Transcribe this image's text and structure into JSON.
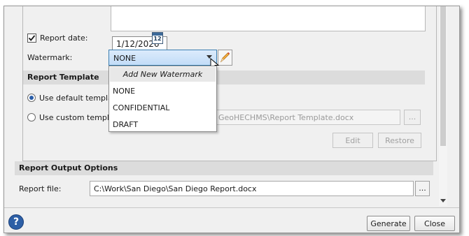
{
  "report_date": {
    "label": "Report date:",
    "checked": true,
    "value": "1/12/2026",
    "calendar_day": "12"
  },
  "watermark": {
    "label": "Watermark:",
    "selected": "NONE",
    "menu": {
      "add_new": "Add New Watermark",
      "options": [
        "NONE",
        "CONFIDENTIAL",
        "DRAFT"
      ]
    }
  },
  "report_template": {
    "title": "Report Template",
    "default_option": "Use default template",
    "custom_option": "Use custom template",
    "custom_path_visible": "GeoHECHMS\\Report Template.docx",
    "browse": "...",
    "edit": "Edit",
    "restore": "Restore"
  },
  "report_output": {
    "title": "Report Output Options",
    "file_label": "Report file:",
    "file_path": "C:\\Work\\San Diego\\San Diego Report.docx",
    "browse": "..."
  },
  "footer": {
    "help": "?",
    "generate": "Generate",
    "close": "Close"
  },
  "colors": {
    "accent": "#3c7fb1",
    "help_icon": "#2d5fa6",
    "pencil": "#e07a1f"
  }
}
